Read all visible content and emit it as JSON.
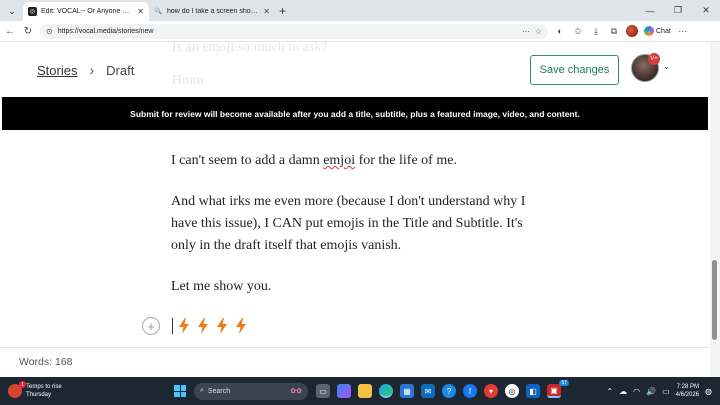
{
  "browser": {
    "tabs": [
      {
        "title": "Edit: VOCAL-- Or Anyone Else, HE",
        "favicon": "vocal-icon",
        "active": true
      },
      {
        "title": "how do I take a screen shot on my",
        "favicon": "search-icon",
        "active": false
      }
    ],
    "url": "https://vocal.media/stories/new",
    "chat_label": "Chat"
  },
  "page": {
    "ghost_top": "Is an emoji so much to ask?",
    "ghost_second": "Hmm",
    "breadcrumb": {
      "stories": "Stories",
      "current": "Draft"
    },
    "save_label": "Save changes",
    "avatar_badge": "V+",
    "banner": "Submit for review will become available after you add a title, subtitle, plus a featured image, video, and content.",
    "paragraphs": {
      "p1_before": "I can't seem to add a damn ",
      "p1_misspelled": "emjoi",
      "p1_after": " for the life of me.",
      "p2": "And what irks me even more (because I don't understand why I have this issue), I CAN put emojis in the Title and Subtitle.   It's only in the draft itself that emojis vanish.",
      "p3": "Let me show you."
    },
    "emoji_count": 4,
    "word_count": "Words: 168"
  },
  "taskbar": {
    "weather_title": "Temps to rise",
    "weather_sub": "Thursday",
    "weather_badge": "1",
    "search_placeholder": "Search",
    "app_badge": "57",
    "time": "7:28 PM",
    "date": "4/6/2026"
  },
  "colors": {
    "accent": "#1f7a5c",
    "banner_bg": "#000000",
    "bolt": "#f07a1a"
  }
}
